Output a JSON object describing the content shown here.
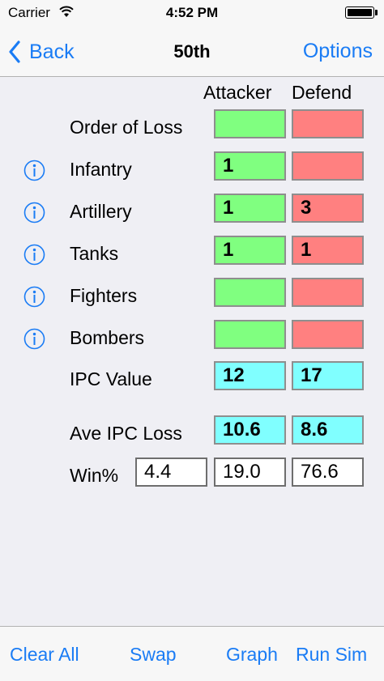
{
  "status": {
    "carrier": "Carrier",
    "time": "4:52 PM"
  },
  "nav": {
    "back_label": "Back",
    "title": "50th",
    "options_label": "Options"
  },
  "columns": {
    "attacker": "Attacker",
    "defend": "Defend"
  },
  "rows": {
    "order_of_loss": {
      "label": "Order of Loss",
      "attacker": "",
      "defender": ""
    },
    "infantry": {
      "label": "Infantry",
      "attacker": "1",
      "defender": ""
    },
    "artillery": {
      "label": "Artillery",
      "attacker": "1",
      "defender": "3"
    },
    "tanks": {
      "label": "Tanks",
      "attacker": "1",
      "defender": "1"
    },
    "fighters": {
      "label": "Fighters",
      "attacker": "",
      "defender": ""
    },
    "bombers": {
      "label": "Bombers",
      "attacker": "",
      "defender": ""
    },
    "ipc_value": {
      "label": "IPC Value",
      "attacker": "12",
      "defender": "17"
    },
    "ave_ipc_loss": {
      "label": "Ave IPC Loss",
      "attacker": "10.6",
      "defender": "8.6"
    },
    "win_pct": {
      "label": "Win%",
      "draw": "4.4",
      "attacker": "19.0",
      "defender": "76.6"
    }
  },
  "toolbar": {
    "clear_all": "Clear All",
    "swap": "Swap",
    "graph": "Graph",
    "run_sim": "Run Sim"
  },
  "colors": {
    "accent": "#1a7cf5",
    "attacker_cell": "#80ff80",
    "defender_cell": "#ff8080",
    "value_cell": "#80ffff"
  },
  "icons": {
    "info": "info-circle-icon",
    "back": "chevron-left-icon"
  }
}
